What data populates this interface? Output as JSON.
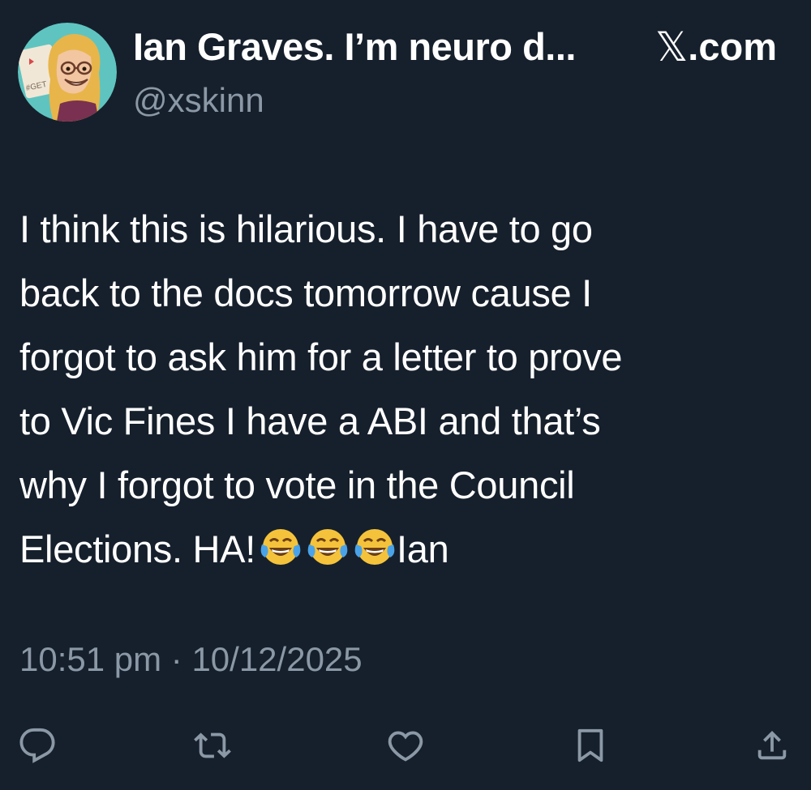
{
  "header": {
    "display_name": "Ian Graves. I’m neuro d...",
    "brand_symbol": "𝕏",
    "brand_text": ".com",
    "handle": "@xskinn",
    "avatar_icon": "avatar-cartoon"
  },
  "tweet": {
    "lines": [
      "I think this is hilarious. I have to go",
      "back to the docs tomorrow cause I",
      "forgot to ask  him for a letter to prove",
      "to Vic Fines I have a ABI and that’s",
      "why I forgot to vote in the Council"
    ],
    "last_line_text": "Elections. HA!",
    "emoji_icon": "tears-of-joy-emoji",
    "emoji_count": 3,
    "signoff": "Ian"
  },
  "meta": {
    "timestamp": "10:51 pm · 10/12/2025"
  },
  "actions": [
    {
      "name": "reply",
      "icon": "reply-icon"
    },
    {
      "name": "retweet",
      "icon": "retweet-icon"
    },
    {
      "name": "like",
      "icon": "heart-icon"
    },
    {
      "name": "bookmark",
      "icon": "bookmark-icon"
    },
    {
      "name": "share",
      "icon": "share-icon"
    }
  ],
  "colors": {
    "background": "#16202c",
    "text": "#ffffff",
    "secondary": "#8b98a5"
  }
}
